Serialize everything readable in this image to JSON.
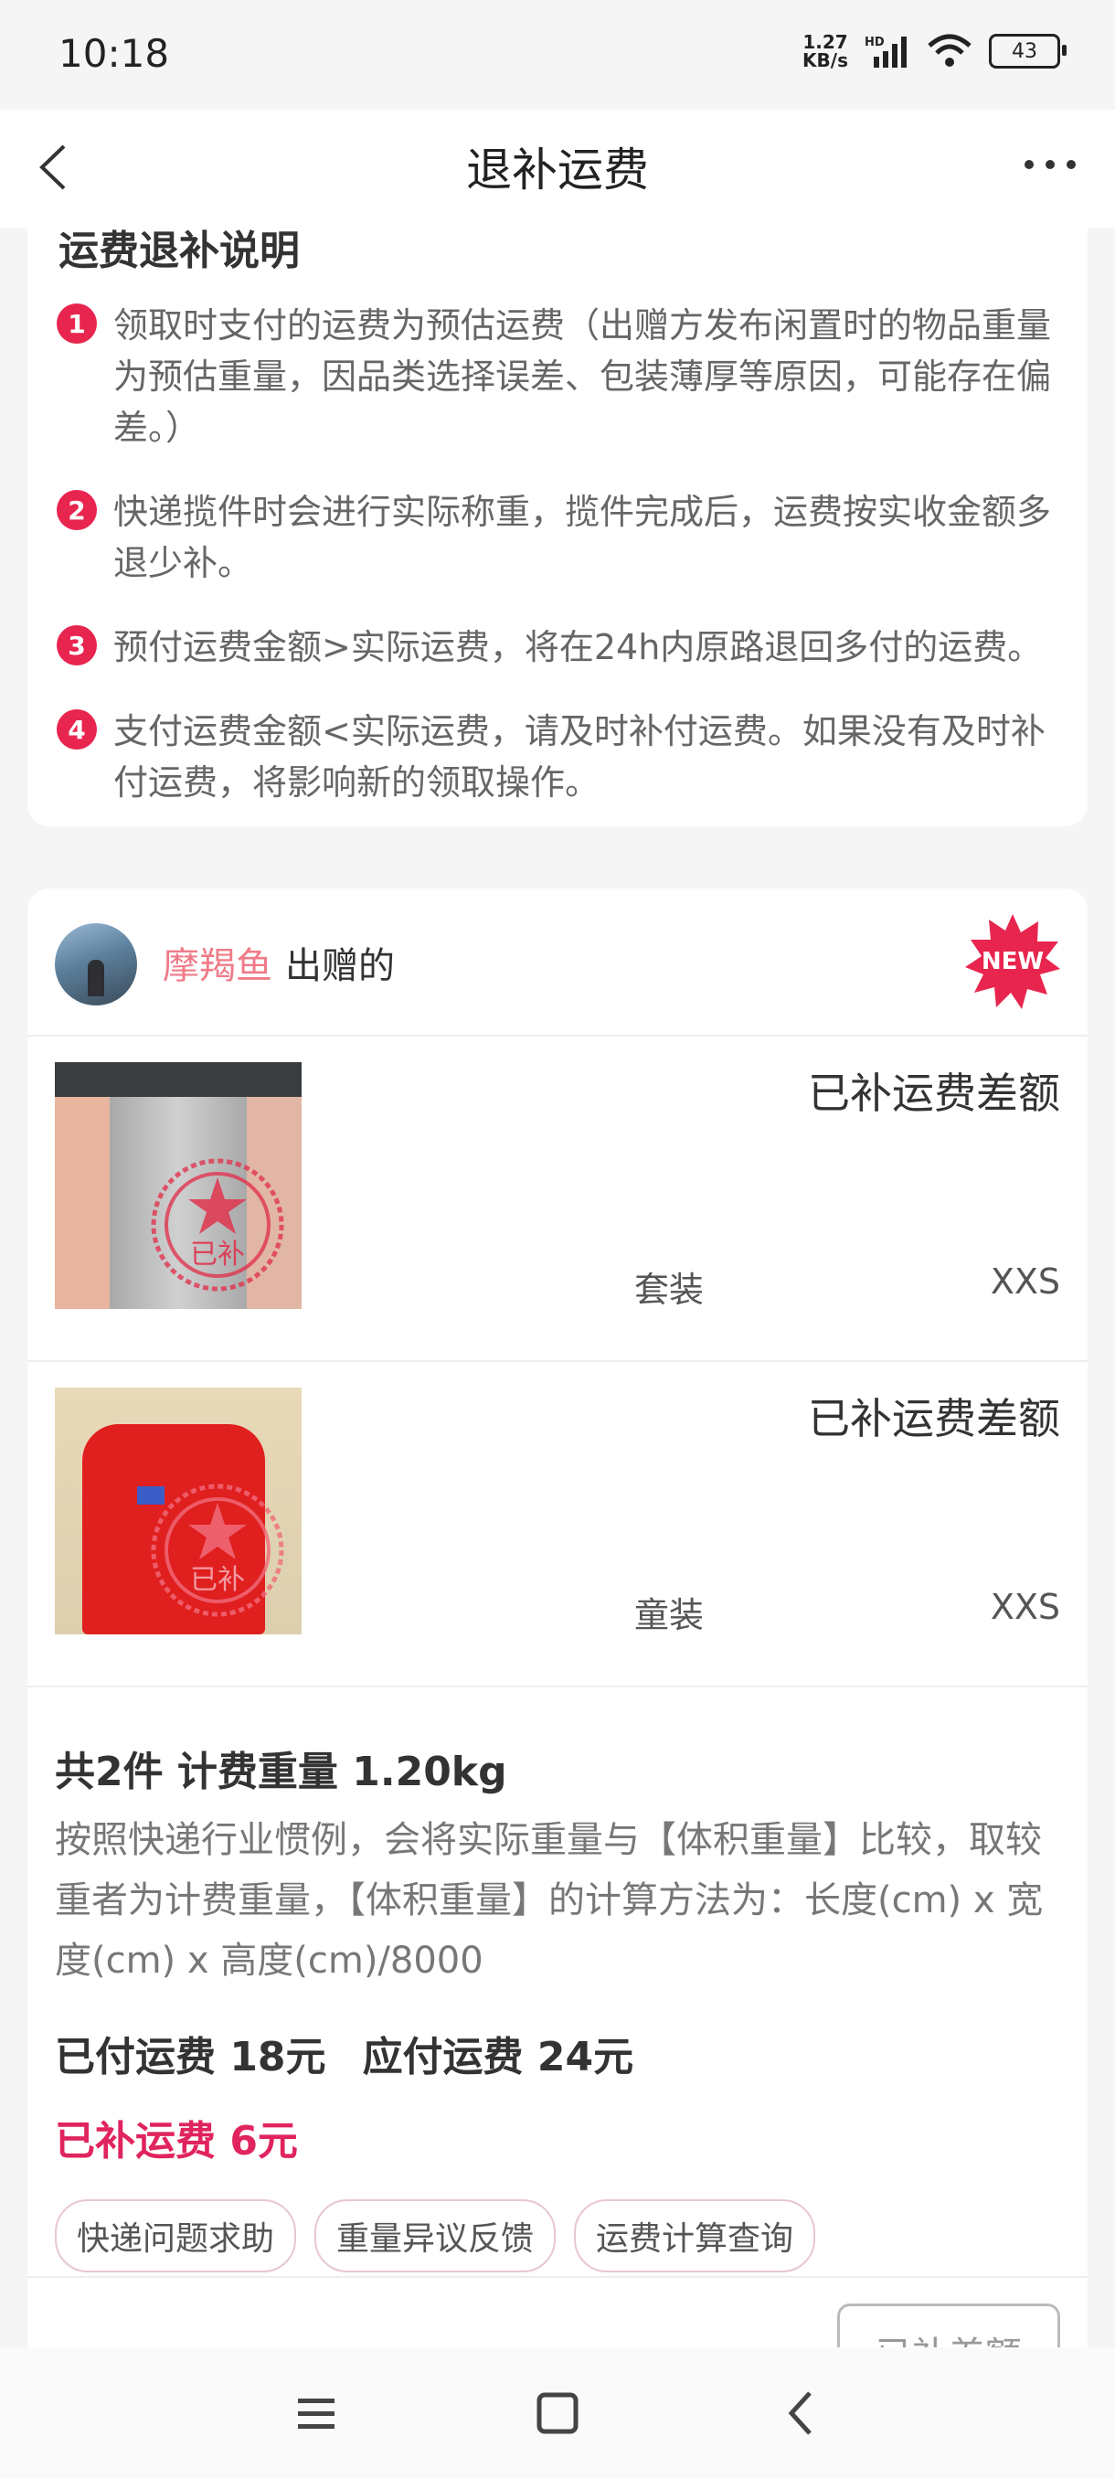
{
  "status": {
    "time": "10:18",
    "speed": "1.27",
    "speed_unit": "KB/s",
    "network": "HD",
    "battery": "43"
  },
  "header": {
    "title": "退补运费"
  },
  "explain": {
    "title": "运费退补说明",
    "rules": [
      {
        "num": "1",
        "text": "领取时支付的运费为预估运费（出赠方发布闲置时的物品重量为预估重量，因品类选择误差、包装薄厚等原因，可能存在偏差。）"
      },
      {
        "num": "2",
        "text": "快递揽件时会进行实际称重，揽件完成后，运费按实收金额多退少补。"
      },
      {
        "num": "3",
        "text": "预付运费金额>实际运费，将在24h内原路退回多付的运费。"
      },
      {
        "num": "4",
        "text": "支付运费金额<实际运费，请及时补付运费。如果没有及时补付运费，将影响新的领取操作。"
      }
    ]
  },
  "donor": {
    "name": "摩羯鱼",
    "suffix": "出赠的",
    "badge": "NEW"
  },
  "items": [
    {
      "status": "已补运费差额",
      "category": "套装",
      "size": "XXS",
      "stamp": "已补"
    },
    {
      "status": "已补运费差额",
      "category": "童装",
      "size": "XXS",
      "stamp": "已补"
    }
  ],
  "summary": {
    "head": "共2件 计费重量 1.20kg",
    "desc": "按照快递行业惯例，会将实际重量与【体积重量】比较，取较重者为计费重量，【体积重量】的计算方法为：长度(cm) x 宽度(cm) x 高度(cm)/8000",
    "paid": "已付运费 18元",
    "due": "应付运费 24元",
    "extra": "已补运费 6元",
    "chips": [
      "快递问题求助",
      "重量异议反馈",
      "运费计算查询"
    ]
  },
  "footer": {
    "button": "已补差额"
  },
  "colors": {
    "accent": "#e8254f",
    "donor_name": "#ef7b88",
    "extra_fee": "#e0245e"
  }
}
